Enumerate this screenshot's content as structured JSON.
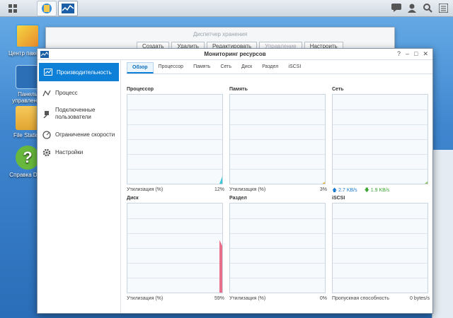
{
  "taskbar": {
    "apps": [
      "storage-manager",
      "resource-monitor"
    ]
  },
  "desktop": {
    "icons": [
      {
        "label": "Центр пакетов"
      },
      {
        "label": "Панель управления"
      },
      {
        "label": "File Station"
      },
      {
        "label": "Справка DSM"
      }
    ]
  },
  "storage_window": {
    "title": "Диспетчер хранения",
    "buttons": [
      "Создать",
      "Удалить",
      "Редактировать",
      "Управление",
      "Настроить"
    ]
  },
  "monitor_window": {
    "title": "Мониторинг ресурсов",
    "nav": [
      {
        "label": "Производительность",
        "selected": true
      },
      {
        "label": "Процесс"
      },
      {
        "label": "Подключенные пользователи"
      },
      {
        "label": "Ограничение скорости"
      },
      {
        "label": "Настройки"
      }
    ],
    "tabs": [
      "Обзор",
      "Процессор",
      "Память",
      "Сеть",
      "Диск",
      "Раздел",
      "iSCSI"
    ],
    "panels": {
      "cpu": {
        "title": "Процессор",
        "label": "Утилизация (%)",
        "value": "12%",
        "level": 0.12,
        "color": "#38c8d8"
      },
      "memory": {
        "title": "Память",
        "label": "Утилизация (%)",
        "value": "3%",
        "level": 0.03,
        "color": "#f0b030"
      },
      "network": {
        "title": "Сеть",
        "upload": "2.7 KB/s",
        "download": "1.9 KB/s",
        "level": 0.04,
        "color": "#8cc060",
        "upload_color": "#1a7ad0",
        "download_color": "#3aa830"
      },
      "disk": {
        "title": "Диск",
        "label": "Утилизация (%)",
        "value": "59%",
        "level": 0.59,
        "color": "#e8708a"
      },
      "partition": {
        "title": "Раздел",
        "label": "Утилизация (%)",
        "value": "0%",
        "level": 0.0
      },
      "iscsi": {
        "title": "iSCSI",
        "label": "Пропускная способность",
        "value": "0 bytes/s",
        "level": 0.0
      }
    }
  }
}
